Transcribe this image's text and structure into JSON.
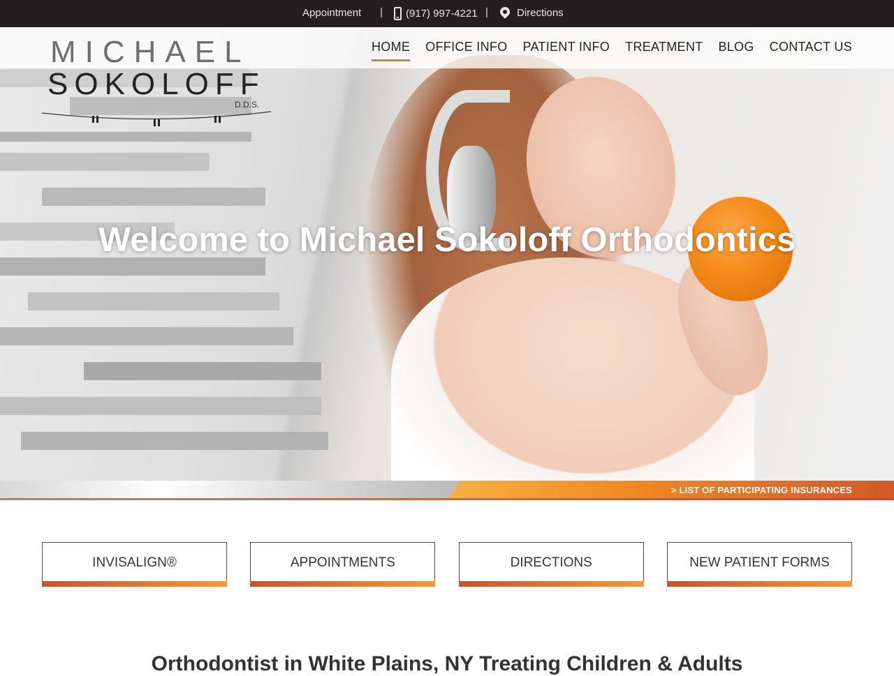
{
  "topbar": {
    "appointment_label": "Appointment",
    "separator": "|",
    "phone": "(917) 997-4221",
    "directions_label": "Directions",
    "icons": {
      "phone": "phone-icon",
      "directions": "map-pin-icon"
    }
  },
  "logo": {
    "line1": "MICHAEL",
    "line2": "SOKOLOFF",
    "line3": "D.D.S."
  },
  "nav": {
    "items": [
      {
        "label": "HOME",
        "active": true
      },
      {
        "label": "OFFICE INFO",
        "active": false
      },
      {
        "label": "PATIENT INFO",
        "active": false
      },
      {
        "label": "TREATMENT",
        "active": false
      },
      {
        "label": "BLOG",
        "active": false
      },
      {
        "label": "CONTACT US",
        "active": false
      }
    ]
  },
  "hero": {
    "title": "Welcome to Michael Sokoloff Orthodontics"
  },
  "insurance": {
    "link_label": "> LIST OF PARTICIPATING INSURANCES"
  },
  "cta": {
    "buttons": [
      {
        "label": "INVISALIGN®"
      },
      {
        "label": "APPOINTMENTS"
      },
      {
        "label": "DIRECTIONS"
      },
      {
        "label": "NEW PATIENT FORMS"
      }
    ]
  },
  "main": {
    "heading": "Orthodontist in White Plains, NY Treating Children & Adults"
  },
  "colors": {
    "topbar_bg": "#231f20",
    "accent_orange": "#f08a24",
    "accent_rust": "#c8532a"
  }
}
